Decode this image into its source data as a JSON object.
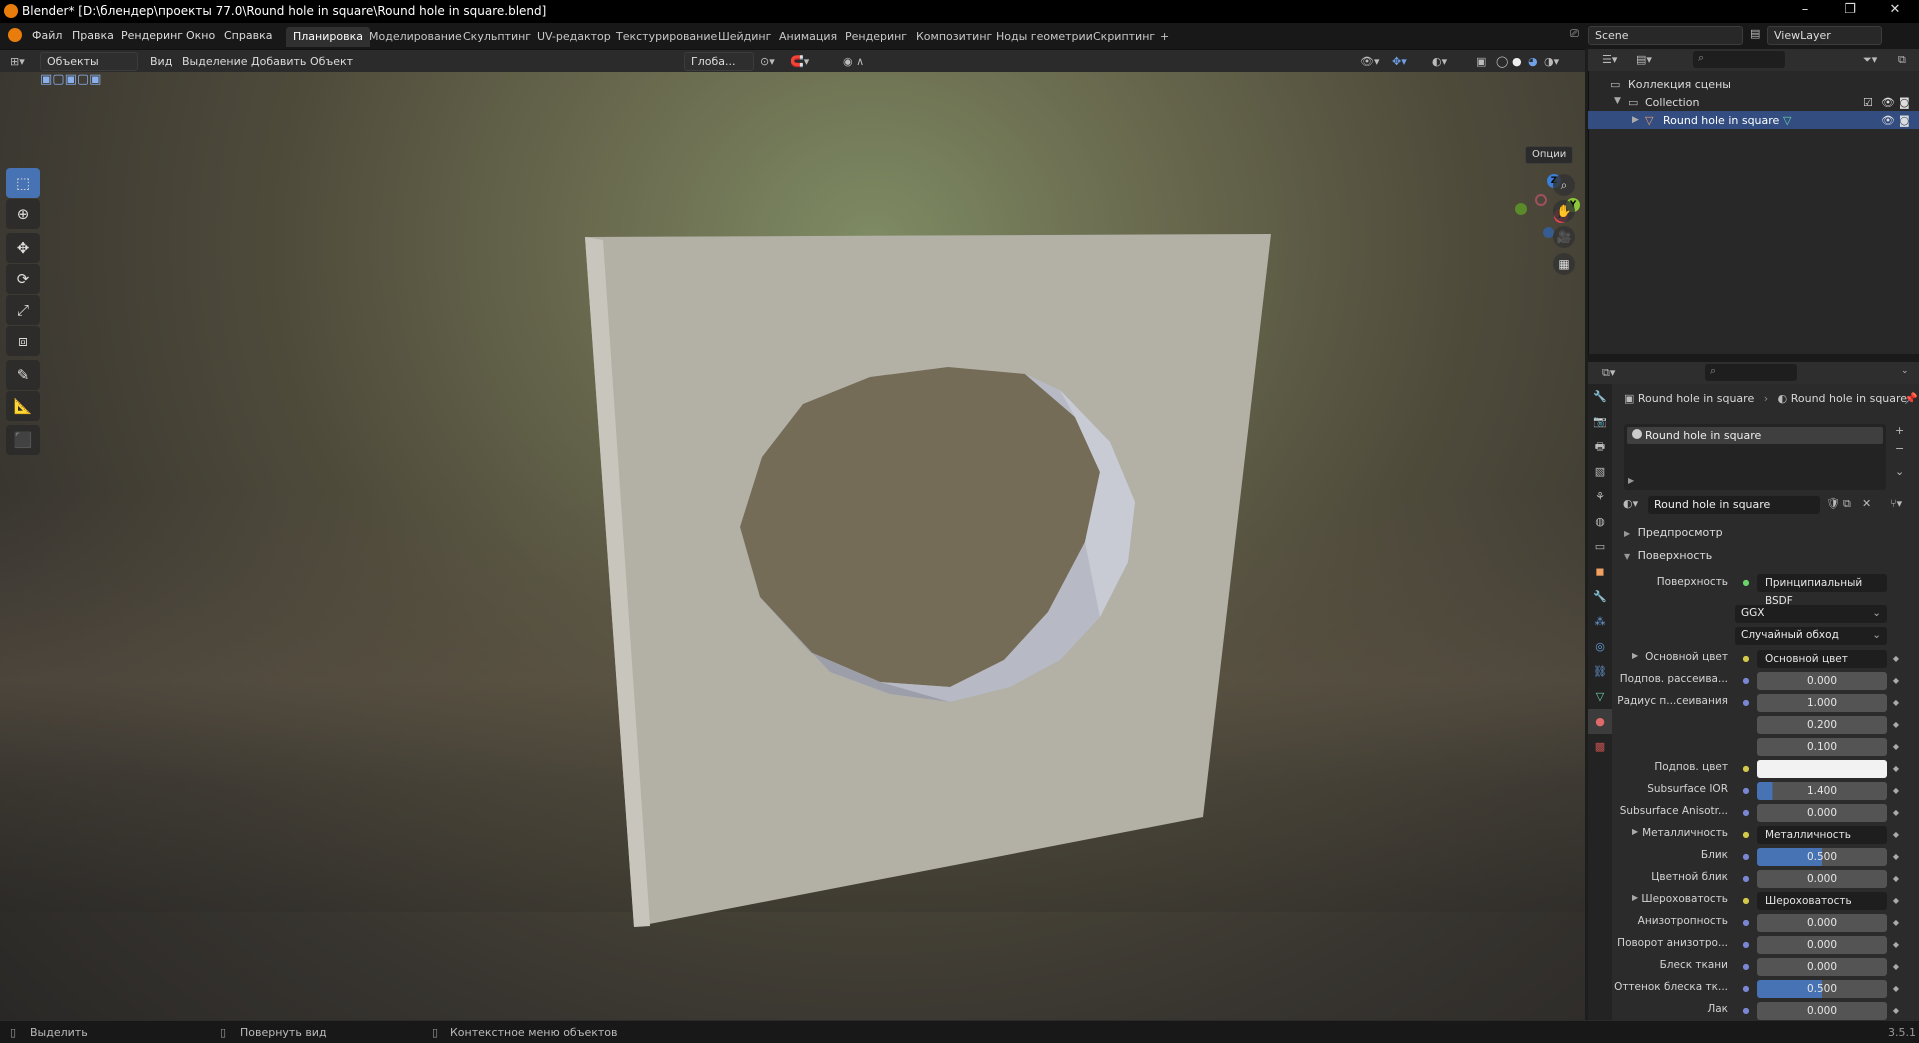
{
  "titlebar": {
    "title": "Blender* [D:\\блендер\\проекты 77.0\\Round hole in square\\Round hole in square.blend]",
    "min": "–",
    "max": "❐",
    "close": "✕"
  },
  "menus": [
    "Файл",
    "Правка",
    "Рендеринг",
    "Окно",
    "Справка"
  ],
  "workspaces": [
    "Планировка",
    "Моделирование",
    "Скульптинг",
    "UV-редактор",
    "Текстурирование",
    "Шейдинг",
    "Анимация",
    "Рендеринг",
    "Композитинг",
    "Ноды геометрии",
    "Скриптинг",
    "+"
  ],
  "scene": {
    "name": "Scene",
    "viewlayer": "ViewLayer"
  },
  "viewport_header": {
    "mode": "Объекты",
    "menus": [
      "Вид",
      "Выделение",
      "Добавить",
      "Объект"
    ],
    "transform": "Глоба...",
    "options": "Опции"
  },
  "gizmo": {
    "z": "Z",
    "y": "Y",
    "x": "X"
  },
  "outliner": {
    "scene_collection": "Коллекция сцены",
    "collection": "Collection",
    "object": "Round hole in square"
  },
  "properties": {
    "breadcrumb_object": "Round hole in square",
    "breadcrumb_material": "Round hole in square",
    "slot": "Round hole in square",
    "material_name": "Round hole in square",
    "sections": {
      "preview": "Предпросмотр",
      "surface": "Поверхность"
    },
    "surface_label": "Поверхность",
    "surface_value": "Принципиальный BSDF",
    "distribution": "GGX",
    "subsurface_method": "Случайный обход",
    "rows": [
      {
        "label": "Основной цвет",
        "value": "Основной цвет",
        "kind": "link"
      },
      {
        "label": "Подпов. рассеива...",
        "value": "0.000",
        "kind": "num"
      },
      {
        "label": "Радиус п...сеивания",
        "value": "1.000",
        "kind": "num"
      },
      {
        "label": "",
        "value": "0.200",
        "kind": "num"
      },
      {
        "label": "",
        "value": "0.100",
        "kind": "num"
      },
      {
        "label": "Подпов. цвет",
        "value": "",
        "kind": "color"
      },
      {
        "label": "Subsurface IOR",
        "value": "1.400",
        "kind": "slider",
        "fill": 0.12
      },
      {
        "label": "Subsurface Anisotr...",
        "value": "0.000",
        "kind": "num"
      },
      {
        "label": "Металличность",
        "value": "Металличность",
        "kind": "link"
      },
      {
        "label": "Блик",
        "value": "0.500",
        "kind": "slider",
        "fill": 0.5
      },
      {
        "label": "Цветной блик",
        "value": "0.000",
        "kind": "num"
      },
      {
        "label": "Шероховатость",
        "value": "Шероховатость",
        "kind": "link"
      },
      {
        "label": "Анизотропность",
        "value": "0.000",
        "kind": "num"
      },
      {
        "label": "Поворот анизотро...",
        "value": "0.000",
        "kind": "num"
      },
      {
        "label": "Блеск ткани",
        "value": "0.000",
        "kind": "num"
      },
      {
        "label": "Оттенок блеска тк...",
        "value": "0.500",
        "kind": "slider",
        "fill": 0.5
      },
      {
        "label": "Лак",
        "value": "0.000",
        "kind": "num"
      }
    ]
  },
  "statusbar": {
    "select": "Выделить",
    "rotate": "Повернуть вид",
    "context": "Контекстное меню объектов",
    "version": "3.5.1"
  },
  "colors": {
    "accent": "#4772b3",
    "selection": "#334d80",
    "object": "#b3b1a6"
  }
}
